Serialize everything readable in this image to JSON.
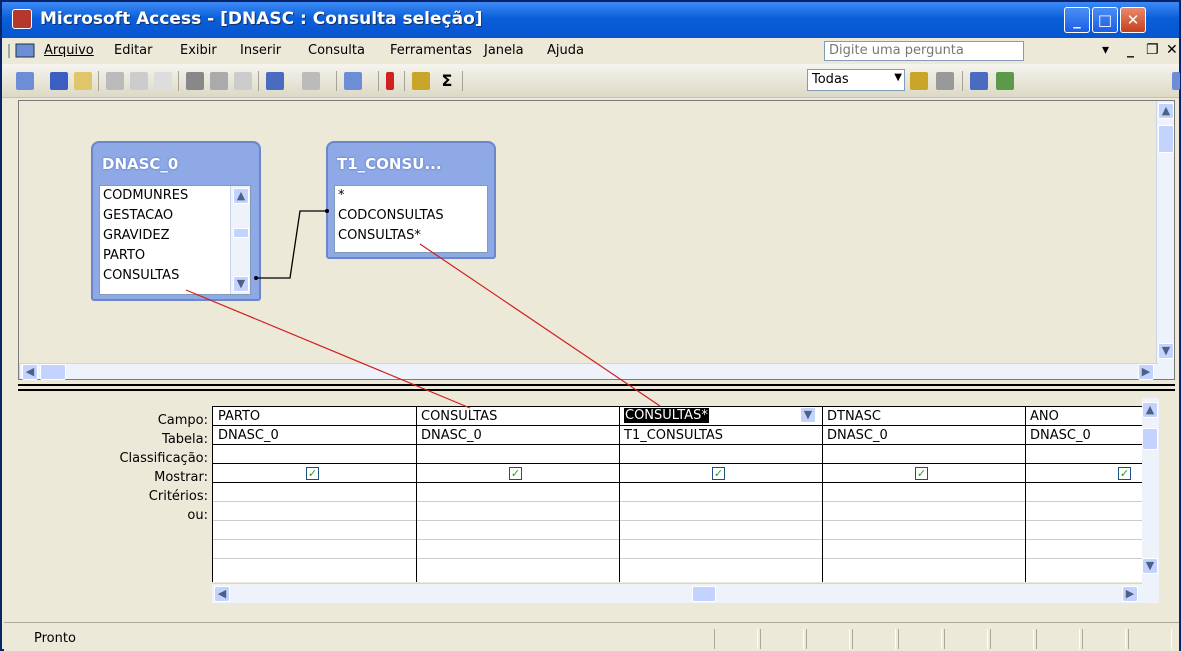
{
  "window": {
    "title": "Microsoft Access - [DNASC : Consulta seleção]"
  },
  "menu": [
    "Arquivo",
    "Editar",
    "Exibir",
    "Inserir",
    "Consulta",
    "Ferramentas",
    "Janela",
    "Ajuda"
  ],
  "ask_placeholder": "Digite uma pergunta",
  "toolbar": {
    "query_type": "Todas",
    "sigma": "Σ"
  },
  "tables": [
    {
      "name": "DNASC_0",
      "fields": [
        "CODMUNRES",
        "GESTACAO",
        "GRAVIDEZ",
        "PARTO",
        "CONSULTAS"
      ]
    },
    {
      "name": "T1_CONSU...",
      "fields": [
        "*",
        "CODCONSULTAS",
        "CONSULTAS*"
      ]
    }
  ],
  "grid": {
    "row_labels": [
      "Campo:",
      "Tabela:",
      "Classificação:",
      "Mostrar:",
      "Critérios:",
      "ou:"
    ],
    "columns": [
      {
        "campo": "PARTO",
        "tabela": "DNASC_0",
        "mostrar": true
      },
      {
        "campo": "CONSULTAS",
        "tabela": "DNASC_0",
        "mostrar": true
      },
      {
        "campo": "CONSULTAS*",
        "tabela": "T1_CONSULTAS",
        "mostrar": true
      },
      {
        "campo": "DTNASC",
        "tabela": "DNASC_0",
        "mostrar": true
      },
      {
        "campo": "ANO",
        "tabela": "DNASC_0",
        "mostrar": true
      }
    ]
  },
  "status": {
    "text": "Pronto"
  },
  "colors": {
    "title_bar": "#0a5fd8",
    "field_list": "#8ea9e6",
    "check": "#21a121",
    "annotation": "#d02020"
  }
}
